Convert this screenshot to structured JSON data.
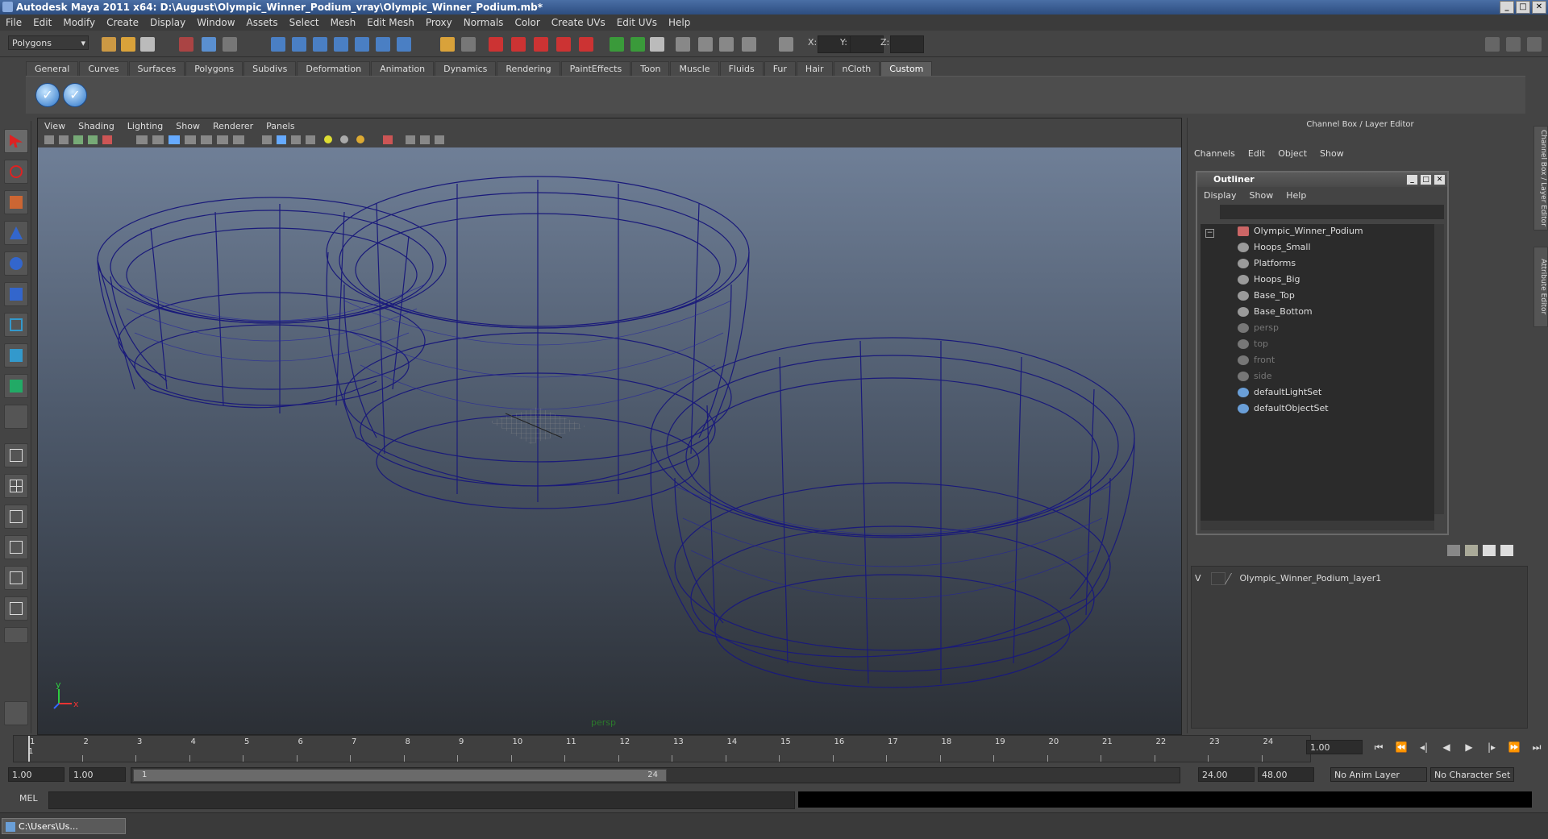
{
  "window": {
    "title": "Autodesk Maya 2011 x64: D:\\August\\Olympic_Winner_Podium_vray\\Olympic_Winner_Podium.mb*",
    "buttons": [
      "_",
      "□",
      "✕"
    ]
  },
  "menubar": [
    "File",
    "Edit",
    "Modify",
    "Create",
    "Display",
    "Window",
    "Assets",
    "Select",
    "Mesh",
    "Edit Mesh",
    "Proxy",
    "Normals",
    "Color",
    "Create UVs",
    "Edit UVs",
    "Help"
  ],
  "statusline": {
    "mode": "Polygons",
    "x_label": "X:",
    "y_label": "Y:",
    "z_label": "Z:"
  },
  "shelf": {
    "tabs": [
      "General",
      "Curves",
      "Surfaces",
      "Polygons",
      "Subdivs",
      "Deformation",
      "Animation",
      "Dynamics",
      "Rendering",
      "PaintEffects",
      "Toon",
      "Muscle",
      "Fluids",
      "Fur",
      "Hair",
      "nCloth",
      "Custom"
    ],
    "active_tab": "Custom"
  },
  "viewport": {
    "menu": [
      "View",
      "Shading",
      "Lighting",
      "Show",
      "Renderer",
      "Panels"
    ],
    "camera_label": "persp",
    "axis_x": "x",
    "axis_y": "y",
    "wire_color": "#1a1a7a"
  },
  "channelbox": {
    "title": "Channel Box / Layer Editor",
    "menu": [
      "Channels",
      "Edit",
      "Object",
      "Show"
    ]
  },
  "outliner": {
    "title": "Outliner",
    "menu": [
      "Display",
      "Show",
      "Help"
    ],
    "items": [
      {
        "label": "Olympic_Winner_Podium",
        "indent": 0,
        "dim": false,
        "icon": "transform-icon"
      },
      {
        "label": "Hoops_Small",
        "indent": 1,
        "dim": false,
        "icon": "mesh-icon"
      },
      {
        "label": "Platforms",
        "indent": 1,
        "dim": false,
        "icon": "mesh-icon"
      },
      {
        "label": "Hoops_Big",
        "indent": 1,
        "dim": false,
        "icon": "mesh-icon"
      },
      {
        "label": "Base_Top",
        "indent": 1,
        "dim": false,
        "icon": "mesh-icon"
      },
      {
        "label": "Base_Bottom",
        "indent": 1,
        "dim": false,
        "icon": "mesh-icon"
      },
      {
        "label": "persp",
        "indent": 0,
        "dim": true,
        "icon": "camera-icon"
      },
      {
        "label": "top",
        "indent": 0,
        "dim": true,
        "icon": "camera-icon"
      },
      {
        "label": "front",
        "indent": 0,
        "dim": true,
        "icon": "camera-icon"
      },
      {
        "label": "side",
        "indent": 0,
        "dim": true,
        "icon": "camera-icon"
      },
      {
        "label": "defaultLightSet",
        "indent": 0,
        "dim": false,
        "icon": "set-icon"
      },
      {
        "label": "defaultObjectSet",
        "indent": 0,
        "dim": false,
        "icon": "set-icon"
      }
    ]
  },
  "layers": {
    "visibility": "V",
    "layer_name": "Olympic_Winner_Podium_layer1"
  },
  "side_tabs": [
    "Channel Box / Layer Editor",
    "Attribute Editor"
  ],
  "timeslider": {
    "ticks": [
      "1",
      "2",
      "3",
      "4",
      "5",
      "6",
      "7",
      "8",
      "9",
      "10",
      "11",
      "12",
      "13",
      "14",
      "15",
      "16",
      "17",
      "18",
      "19",
      "20",
      "21",
      "22",
      "23",
      "24"
    ],
    "current_frame": "1.00",
    "current_marker": "1"
  },
  "range": {
    "start": "1.00",
    "playback_start": "1.00",
    "thumb_start": "1",
    "thumb_end": "24",
    "playback_end": "24.00",
    "end": "48.00",
    "anim_layer": "No Anim Layer",
    "character_set": "No Character Set"
  },
  "command": {
    "label": "MEL"
  },
  "taskbar": {
    "item": "C:\\Users\\Us..."
  }
}
